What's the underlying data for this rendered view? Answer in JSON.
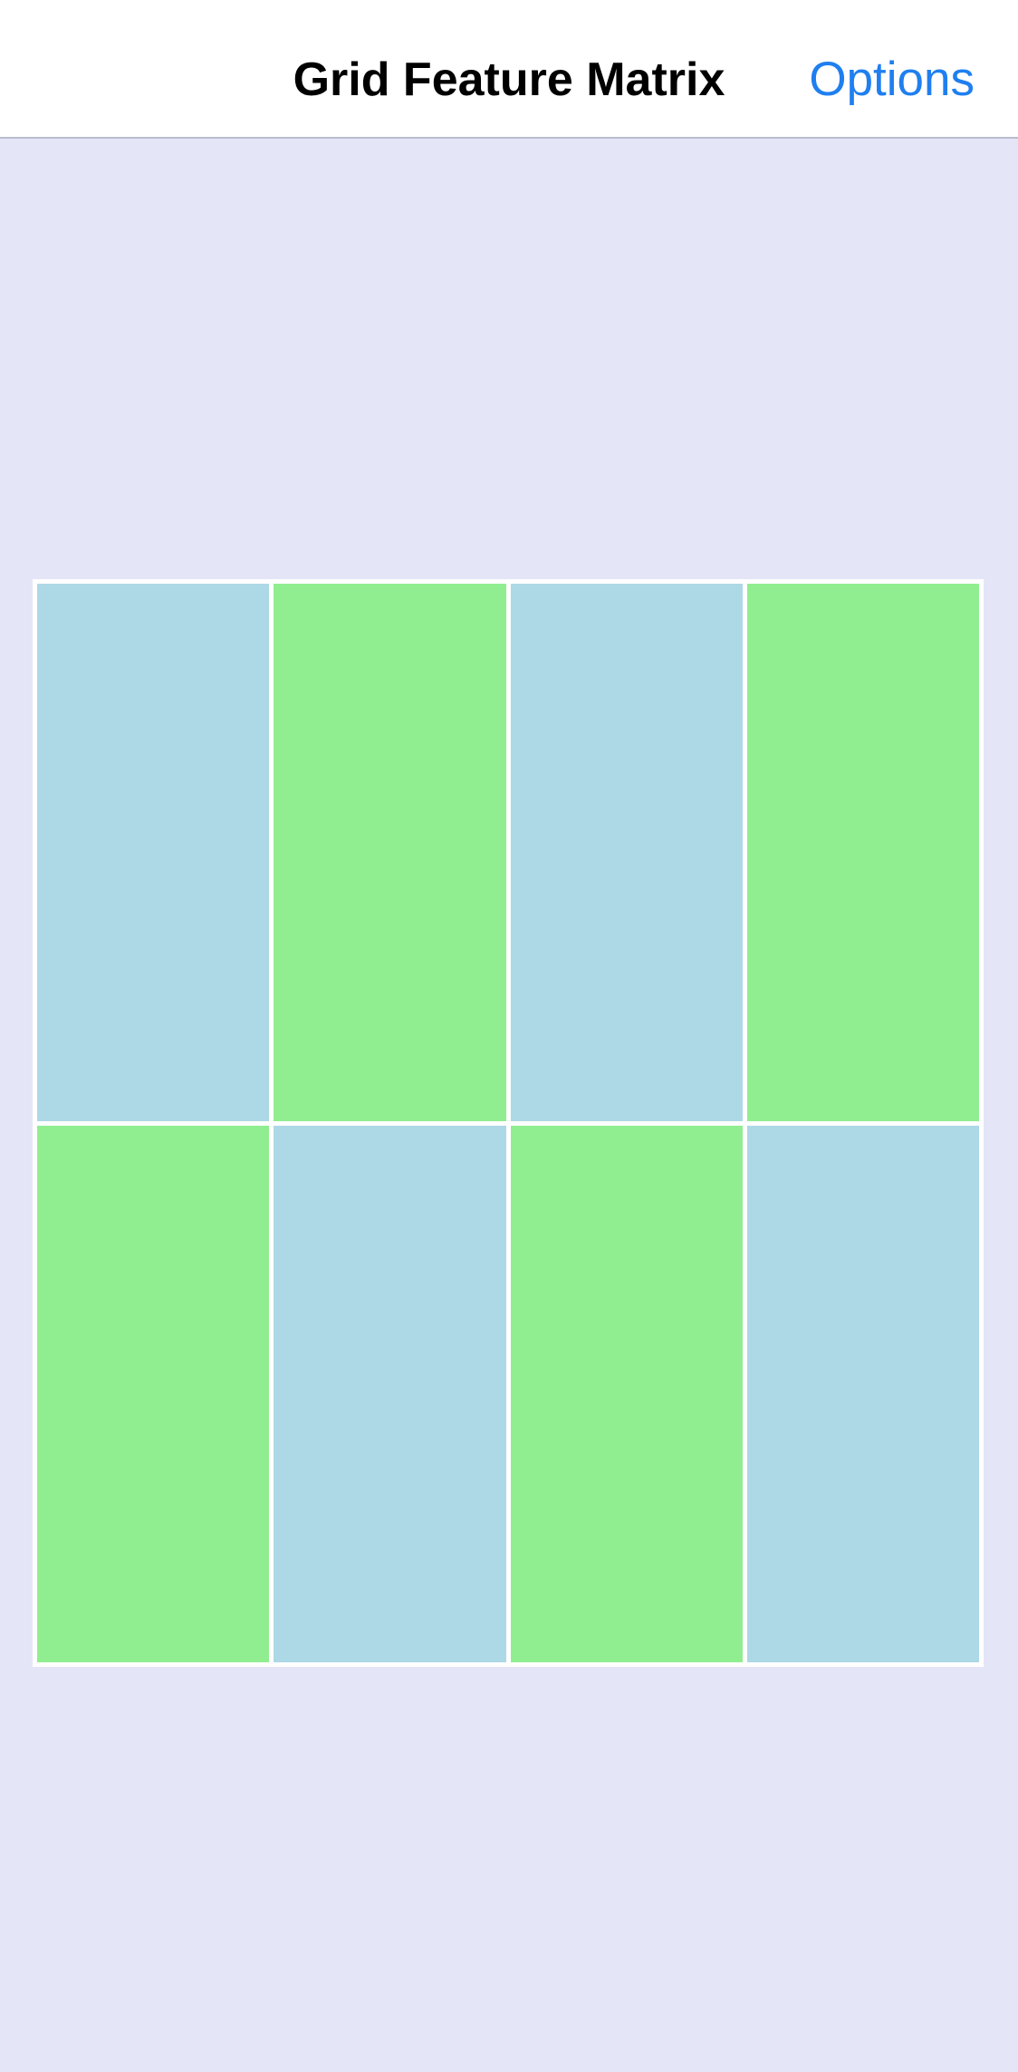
{
  "nav": {
    "title": "Grid Feature Matrix",
    "action_label": "Options"
  },
  "colors": {
    "background": "#e5e5f8",
    "nav_background": "#ffffff",
    "accent": "#1f7ff0",
    "grid_border": "#ffffff",
    "cell_blue": "#add8e6",
    "cell_green": "#90ee90"
  },
  "grid": {
    "columns": 4,
    "rows": 2,
    "cells": [
      {
        "color": "#add8e6"
      },
      {
        "color": "#90ee90"
      },
      {
        "color": "#add8e6"
      },
      {
        "color": "#90ee90"
      },
      {
        "color": "#90ee90"
      },
      {
        "color": "#add8e6"
      },
      {
        "color": "#90ee90"
      },
      {
        "color": "#add8e6"
      }
    ]
  }
}
